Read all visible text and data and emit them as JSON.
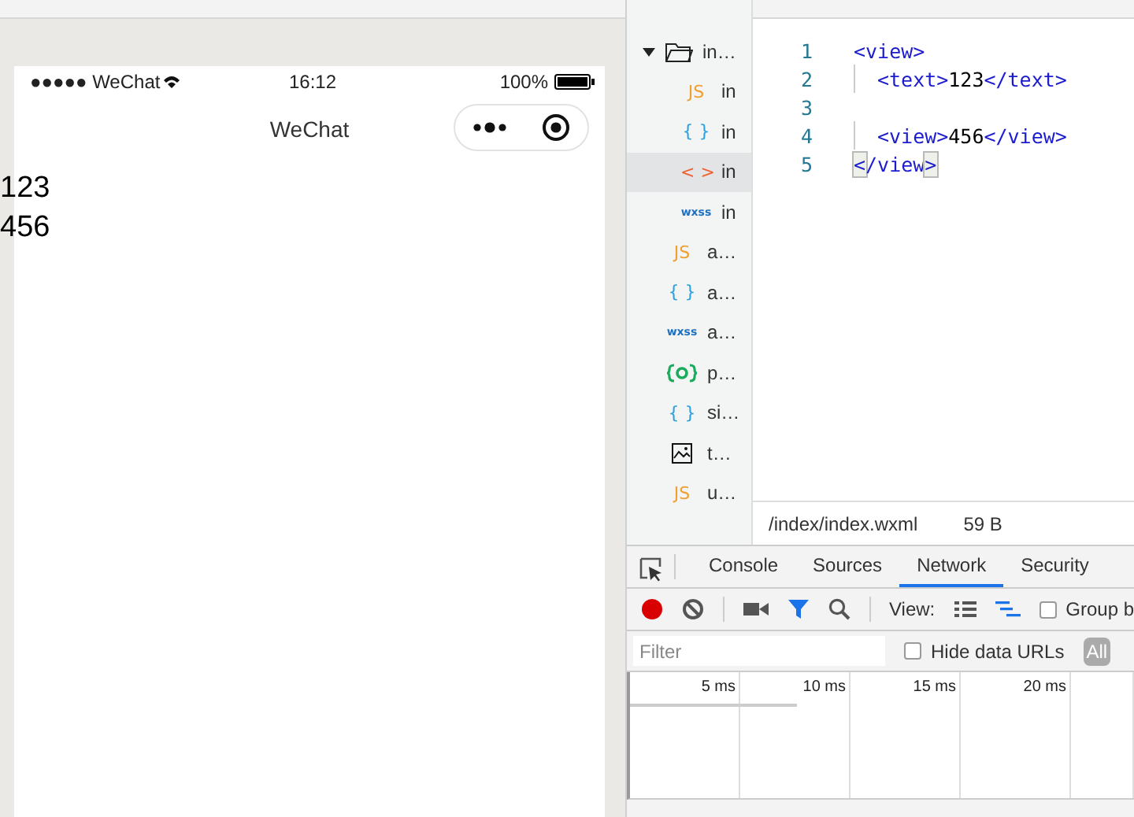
{
  "phone": {
    "status_bar": {
      "carrier": "●●●●● WeChat",
      "time": "16:12",
      "battery": "100%"
    },
    "nav_bar": {
      "title": "WeChat"
    },
    "content": [
      "123",
      "456"
    ]
  },
  "file_tree": [
    {
      "kind": "folder",
      "label": "in…",
      "expanded": true,
      "selected": false,
      "children": [
        {
          "kind": "file",
          "badge": "JS",
          "color": "#f0a030",
          "label": "in",
          "selected": false
        },
        {
          "kind": "file",
          "badge": "{ }",
          "color": "#2aa0e0",
          "label": "in",
          "selected": false
        },
        {
          "kind": "file",
          "badge": "< >",
          "color": "#f06030",
          "label": "in",
          "selected": true
        },
        {
          "kind": "file",
          "badge": "wxss",
          "color": "#2070c0",
          "label": "in",
          "selected": false
        }
      ]
    },
    {
      "kind": "file",
      "badge": "JS",
      "color": "#f0a030",
      "label": "a…",
      "selected": false
    },
    {
      "kind": "file",
      "badge": "{ }",
      "color": "#2aa0e0",
      "label": "a…",
      "selected": false
    },
    {
      "kind": "file",
      "badge": "wxss",
      "color": "#2070c0",
      "label": "a…",
      "selected": false
    },
    {
      "kind": "config",
      "label": "p…",
      "selected": false
    },
    {
      "kind": "file",
      "badge": "{ }",
      "color": "#2aa0e0",
      "label": "si…",
      "selected": false
    },
    {
      "kind": "image",
      "label": "t…",
      "selected": false
    },
    {
      "kind": "file",
      "badge": "JS",
      "color": "#f0a030",
      "label": "u…",
      "selected": false
    }
  ],
  "editor": {
    "lines": [
      {
        "number": "1",
        "indented": false,
        "segments": [
          {
            "kind": "tag",
            "text": "<view>"
          }
        ]
      },
      {
        "number": "2",
        "indented": true,
        "segments": [
          {
            "kind": "tag",
            "text": "<text>"
          },
          {
            "kind": "text",
            "text": "123"
          },
          {
            "kind": "tag",
            "text": "</text>"
          }
        ]
      },
      {
        "number": "3",
        "indented": false
      },
      {
        "number": "4",
        "indented": true,
        "segments": [
          {
            "kind": "tag",
            "text": "<view>"
          },
          {
            "kind": "text",
            "text": "456"
          },
          {
            "kind": "tag",
            "text": "</view>"
          }
        ]
      },
      {
        "number": "5",
        "indented": false,
        "segments": [
          {
            "kind": "match",
            "text": "<"
          },
          {
            "kind": "tag",
            "text": "/view"
          },
          {
            "kind": "match",
            "text": ">"
          }
        ]
      }
    ],
    "path": "/index/index.wxml",
    "size": "59 B"
  },
  "devtools": {
    "tabs": [
      {
        "label": "Console",
        "selected": false
      },
      {
        "label": "Sources",
        "selected": false
      },
      {
        "label": "Network",
        "selected": true
      },
      {
        "label": "Security",
        "selected": false
      }
    ],
    "recording": true,
    "filter_active": true,
    "view_label": "View:",
    "waterfall_view": true,
    "group_label": "Group b",
    "group_checked": false,
    "filter": {
      "placeholder": "Filter"
    },
    "hide_data_urls": {
      "label": "Hide data URLs",
      "checked": false
    },
    "all_button": {
      "label": "All",
      "selected": true
    },
    "timeline_ticks": [
      "5 ms",
      "10 ms",
      "15 ms",
      "20 ms"
    ]
  }
}
